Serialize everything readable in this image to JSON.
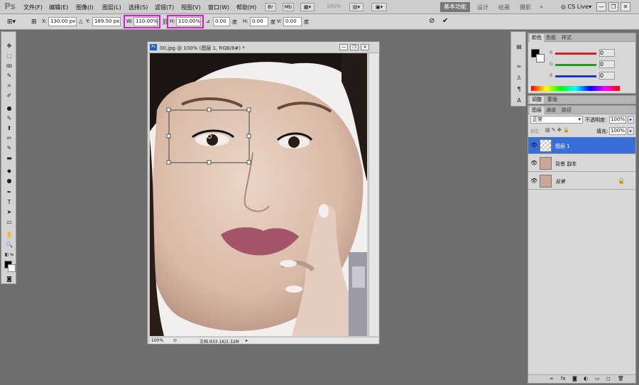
{
  "app": {
    "logo": "Ps"
  },
  "menu": [
    "文件(F)",
    "编辑(E)",
    "图像(I)",
    "图层(L)",
    "选择(S)",
    "滤镜(T)",
    "视图(V)",
    "窗口(W)",
    "帮助(H)"
  ],
  "toolbar": {
    "br": "Br",
    "mb": "Mb",
    "zoom": "100%"
  },
  "workspaces": {
    "active": "基本功能",
    "items": [
      "设计",
      "绘画",
      "摄影"
    ],
    "more": "»",
    "cs_live": "CS Live▾"
  },
  "window_buttons": {
    "minimize": "—",
    "restore": "❐",
    "close": "✕"
  },
  "options": {
    "x_label": "X:",
    "x_value": "130.00 px",
    "y_label": "Y:",
    "y_value": "189.50 px",
    "w_label": "W:",
    "w_value": "110.00%",
    "h_label": "H:",
    "h_value": "110.00%",
    "angle_value": "0.00",
    "angle_unit": "度",
    "hskew_label": "H:",
    "hskew_value": "0.00",
    "hskew_unit": "度",
    "vskew_label": "V:",
    "vskew_value": "0.00",
    "vskew_unit": "度",
    "cancel_icon": "⊘",
    "commit_icon": "✔"
  },
  "tools": [
    "✥",
    "⬚",
    "ꝏ",
    "✎",
    "⌗",
    "✐",
    "●",
    "✎",
    "⬆",
    "✏",
    "✎",
    "▬",
    "◆",
    "●",
    "✒",
    "T",
    "➤",
    "▭",
    "✋",
    "🔍"
  ],
  "document": {
    "title": "00.jpg @ 100% (图层 1, RGB/8#) *",
    "zoom": "100%",
    "doc_size": "文档:933.1K/2.32M"
  },
  "color_panel": {
    "tabs": [
      "颜色",
      "色板",
      "样式"
    ],
    "r_label": "R",
    "g_label": "G",
    "b_label": "B",
    "r_value": "0",
    "g_value": "0",
    "b_value": "0",
    "colors": {
      "red": "#d02020",
      "green": "#20a020",
      "blue": "#2030c0"
    }
  },
  "adjust_panel": {
    "tabs": [
      "调整",
      "蒙版"
    ]
  },
  "layers_panel": {
    "tabs": [
      "图层",
      "通道",
      "路径"
    ],
    "blend_mode": "正常",
    "opacity_label": "不透明度:",
    "opacity_value": "100%",
    "lock_label": "锁定:",
    "fill_label": "填充:",
    "fill_value": "100%",
    "layers": [
      {
        "name": "图层 1",
        "selected": true,
        "locked": false
      },
      {
        "name": "背景 副本",
        "selected": false,
        "locked": false
      },
      {
        "name": "背景",
        "selected": false,
        "locked": true
      }
    ],
    "footer_icons": [
      "∞",
      "fx",
      "◙",
      "◐",
      "▭",
      "◻",
      "🗑"
    ]
  }
}
